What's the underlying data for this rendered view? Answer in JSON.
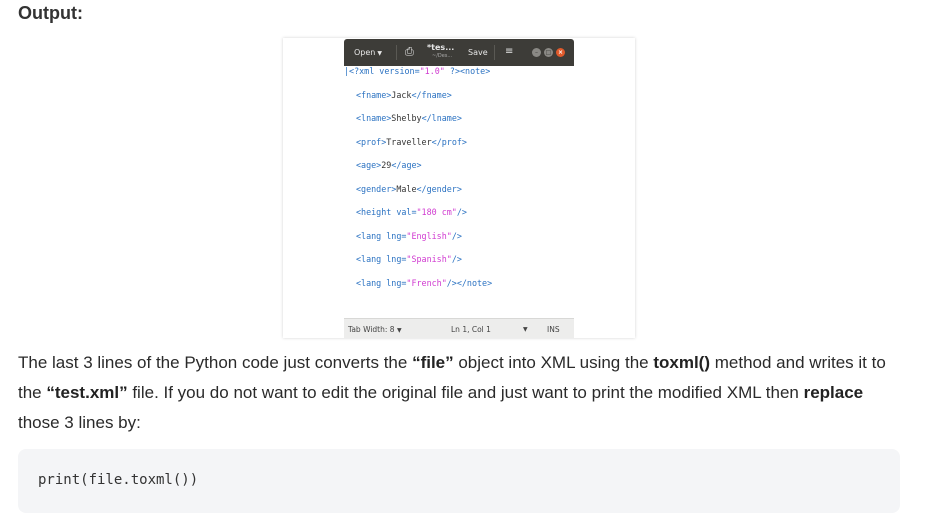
{
  "heading": "Output:",
  "editor": {
    "open_label": "Open",
    "title": "*tes...",
    "subtitle": "~/Des...",
    "save_label": "Save",
    "status": {
      "tab_width": "Tab Width: 8",
      "position": "Ln 1, Col 1",
      "mode": "INS"
    }
  },
  "xml_lines": {
    "l0": {
      "a": "<?xml version=",
      "b": "\"1.0\"",
      "c": " ?><note>"
    },
    "l1": {
      "a": "<fname>",
      "b": "Jack",
      "c": "</fname>"
    },
    "l2": {
      "a": "<lname>",
      "b": "Shelby",
      "c": "</lname>"
    },
    "l3": {
      "a": "<prof>",
      "b": "Traveller",
      "c": "</prof>"
    },
    "l4": {
      "a": "<age>",
      "b": "29",
      "c": "</age>"
    },
    "l5": {
      "a": "<gender>",
      "b": "Male",
      "c": "</gender>"
    },
    "l6": {
      "a": "<height val=",
      "b": "\"180 cm\"",
      "c": "/>"
    },
    "l7": {
      "a": "<lang lng=",
      "b": "\"English\"",
      "c": "/>"
    },
    "l8": {
      "a": "<lang lng=",
      "b": "\"Spanish\"",
      "c": "/>"
    },
    "l9": {
      "a": "<lang lng=",
      "b": "\"French\"",
      "c": "/></note>"
    }
  },
  "paragraph": {
    "p1": "The last 3 lines of the Python code just converts the ",
    "b1": "“file”",
    "p2": " object into XML using the ",
    "b2": "toxml()",
    "p3": " method and writes it to the ",
    "b3": "“test.xml”",
    "p4": " file. If you do not want to edit the original file and just want to print the modified XML then ",
    "b4": "replace",
    "p5": " those 3 lines by:"
  },
  "code": "print(file.toxml())"
}
